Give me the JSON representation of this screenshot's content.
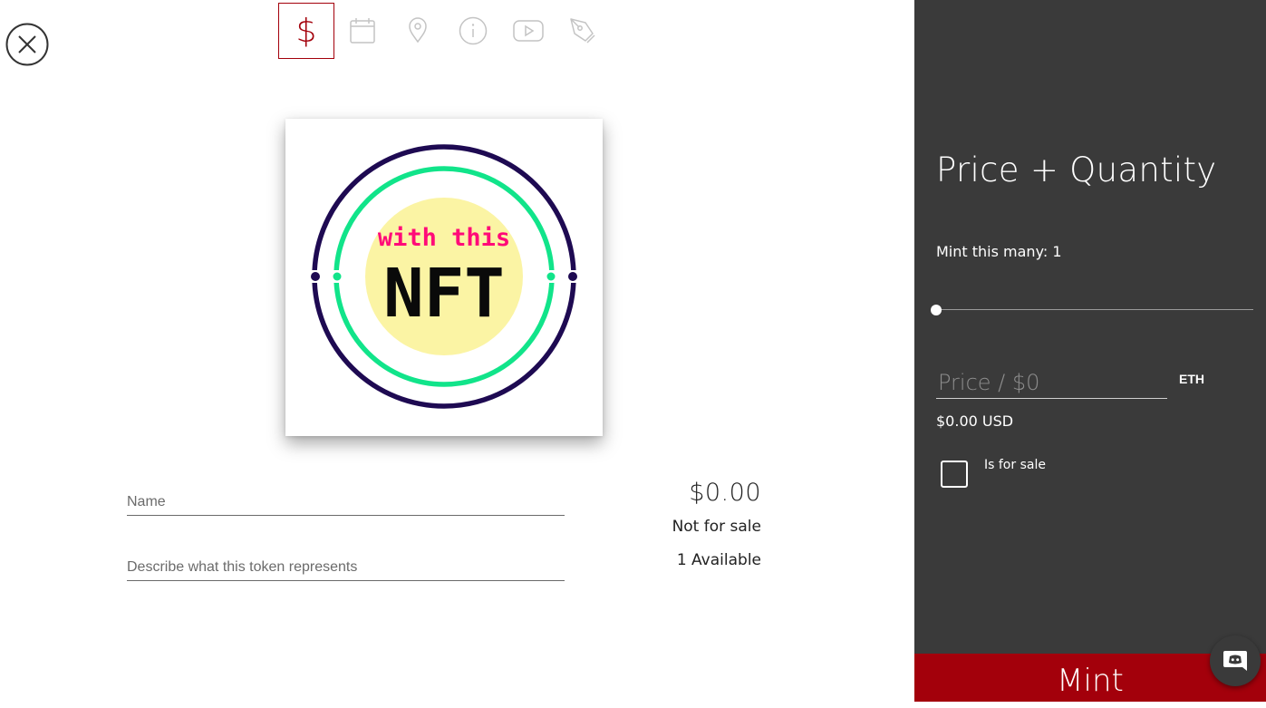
{
  "nav": {
    "close_icon": "close-circle-icon",
    "tabs": [
      {
        "icon": "dollar-icon",
        "glyph": "$",
        "active": true
      },
      {
        "icon": "calendar-icon",
        "active": false
      },
      {
        "icon": "location-pin-icon",
        "active": false
      },
      {
        "icon": "info-icon",
        "active": false
      },
      {
        "icon": "youtube-icon",
        "active": false
      },
      {
        "icon": "pen-icon",
        "active": false
      }
    ]
  },
  "preview": {
    "line1": "with this",
    "line2": "NFT"
  },
  "form": {
    "name_placeholder": "Name",
    "description_placeholder": "Describe what this token represents"
  },
  "summary": {
    "price": "$0.00",
    "sale_status": "Not for sale",
    "available": "1 Available"
  },
  "panel": {
    "title": "Price + Quantity",
    "mint_count": "Mint this many: 1",
    "quantity": 1,
    "price_placeholder": "Price / $0",
    "currency": "ETH",
    "usd_value": "$0.00 USD",
    "for_sale_label": "Is for sale",
    "for_sale_checked": false,
    "mint_label": "Mint"
  },
  "chat": {
    "icon": "discord-icon"
  },
  "colors": {
    "accent": "#a3000b",
    "panel_bg": "#3a3a3a",
    "icon_gray": "#c4c4c4",
    "nft_ring_outer": "#1e0a52",
    "nft_ring_inner": "#11e48a",
    "nft_circle": "#fbf4a4",
    "nft_pink": "#ff0a78"
  }
}
